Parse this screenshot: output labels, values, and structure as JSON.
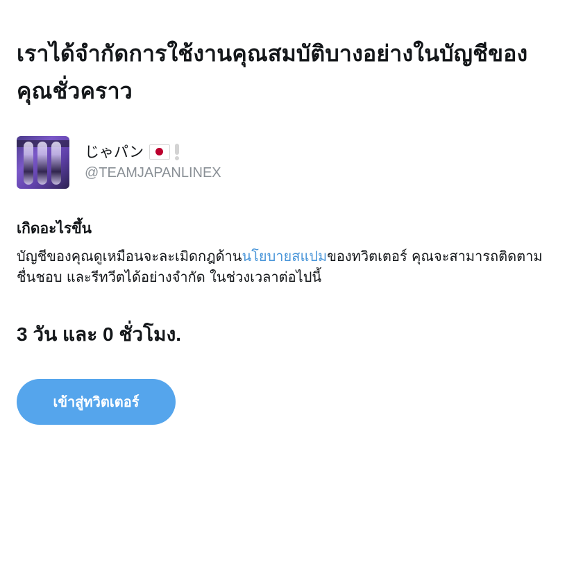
{
  "notice": {
    "title": "เราได้จำกัดการใช้งานคุณสมบัติบางอย่างในบัญชีของคุณชั่วคราว"
  },
  "account": {
    "display_name": "じゃパン",
    "handle": "@TEAMJAPANLINEX",
    "flag_icon": "japan-flag-icon",
    "badge_icon": "exclamation-mark-icon"
  },
  "details": {
    "heading": "เกิดอะไรขึ้น",
    "text_before_link": "บัญชีของคุณดูเหมือนจะละเมิดกฎด้าน",
    "link_text": "นโยบายสแปม",
    "text_after_link": "ของทวิตเตอร์ คุณจะสามารถติดตาม ชื่นชอบ และรีทวีตได้อย่างจำกัด ในช่วงเวลาต่อไปนี้"
  },
  "duration": "3 วัน และ 0 ชั่วโมง.",
  "actions": {
    "continue_label": "เข้าสู่ทวิตเตอร์"
  },
  "colors": {
    "link": "#4a96d9",
    "button": "#55a5ec",
    "text": "#14171a",
    "secondary_text": "#8a9096"
  }
}
